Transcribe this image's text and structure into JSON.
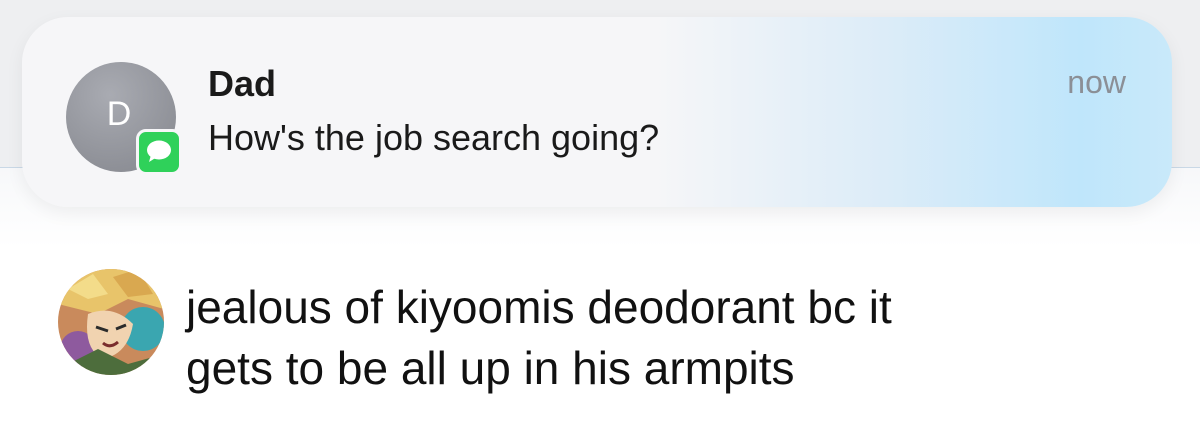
{
  "notification": {
    "sender": "Dad",
    "avatar_initial": "D",
    "message": "How's the job search going?",
    "time": "now",
    "app_icon": "messages-icon",
    "colors": {
      "app_icon": "#2fd15a",
      "avatar": "#8f9198",
      "banner_tint": "#bfe6fb"
    }
  },
  "post": {
    "avatar_icon": "anime-character-avatar",
    "lines": [
      "jealous of kiyoomis deodorant bc it",
      "gets to be all up in his armpits"
    ]
  }
}
